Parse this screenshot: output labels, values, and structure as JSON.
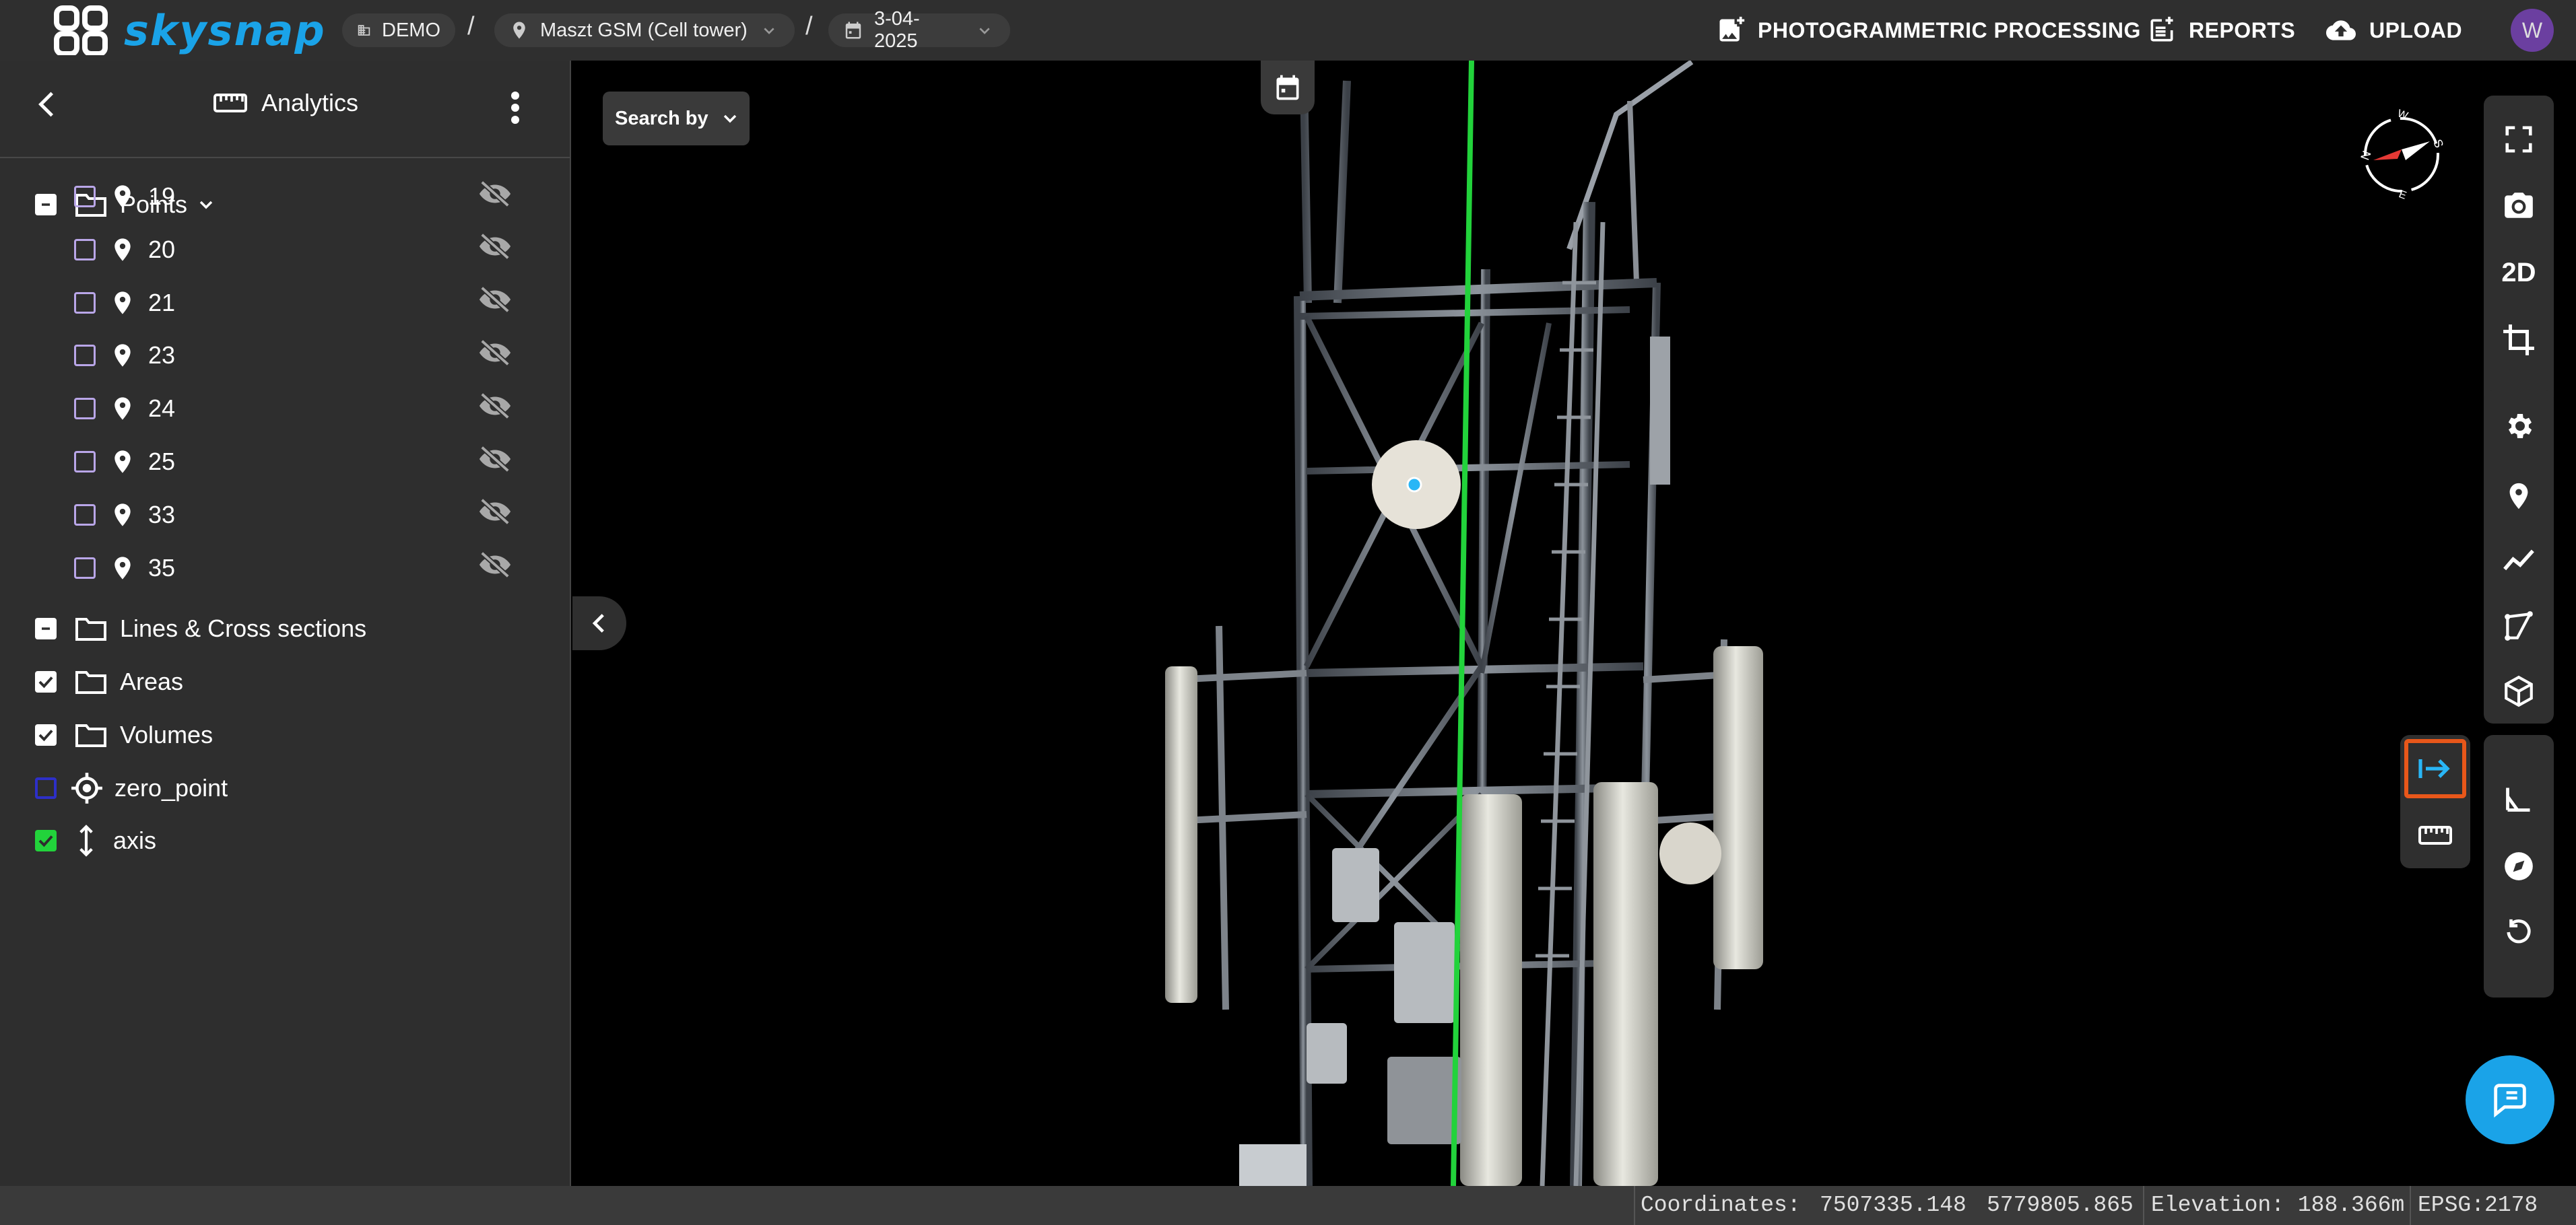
{
  "app": {
    "brand": "skysnap"
  },
  "breadcrumb": {
    "org": "DEMO",
    "separator": "/",
    "project": "Maszt GSM (Cell tower)",
    "date": "3-04-2025"
  },
  "topnav": {
    "processing": "PHOTOGRAMMETRIC PROCESSING",
    "reports": "REPORTS",
    "upload": "UPLOAD",
    "avatar_initial": "W"
  },
  "sidebar": {
    "title": "Analytics",
    "points_label": "Points",
    "points": [
      "19",
      "20",
      "21",
      "23",
      "24",
      "25",
      "33",
      "35"
    ],
    "lines_label": "Lines & Cross sections",
    "areas_label": "Areas",
    "volumes_label": "Volumes",
    "zero_point_label": "zero_point",
    "axis_label": "axis"
  },
  "viewport": {
    "search_label": "Search by",
    "mode_2d": "2D",
    "accent_color": "#e8571a",
    "axis_color": "#22d33b",
    "brand_color": "#1aa3e8"
  },
  "status": {
    "coordinates_label": "Coordinates:",
    "x": "7507335.148",
    "y": "5779805.865",
    "elevation": "Elevation: 188.366m",
    "epsg": "EPSG:2178"
  }
}
